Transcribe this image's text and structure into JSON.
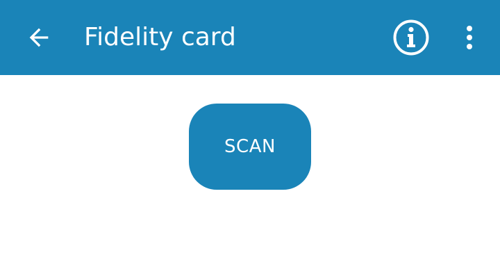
{
  "colors": {
    "primary": "#1a84b8",
    "on_primary": "#ffffff",
    "background": "#ffffff"
  },
  "appbar": {
    "title": "Fidelity card",
    "back_icon": "arrow-back-icon",
    "info_icon": "info-icon",
    "more_icon": "more-vert-icon"
  },
  "main": {
    "scan_label": "SCAN"
  }
}
